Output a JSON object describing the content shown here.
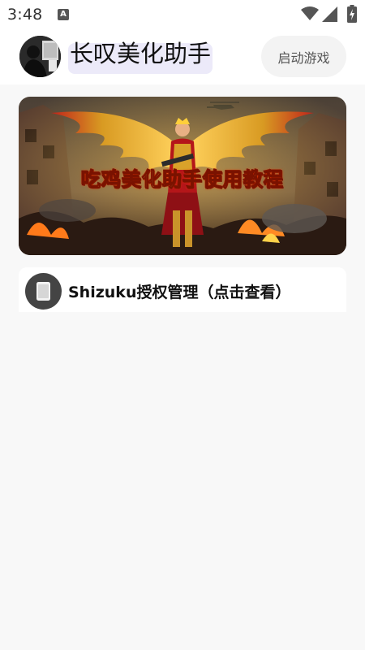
{
  "status_bar": {
    "time": "3:48",
    "icons": [
      "a-notification-icon",
      "wifi-icon",
      "signal-icon",
      "battery-charging-icon"
    ]
  },
  "header": {
    "title": "长叹美化助手",
    "launch_button_label": "启动游戏"
  },
  "banner": {
    "caption": "吃鸡美化助手使用教程"
  },
  "shizuku": {
    "label": "Shizuku授权管理（点击查看）"
  },
  "colors": {
    "background": "#f8f8f8",
    "title_highlight": "#eceaf9",
    "button_bg": "#f3f3f3",
    "icon_dark": "#444444"
  }
}
